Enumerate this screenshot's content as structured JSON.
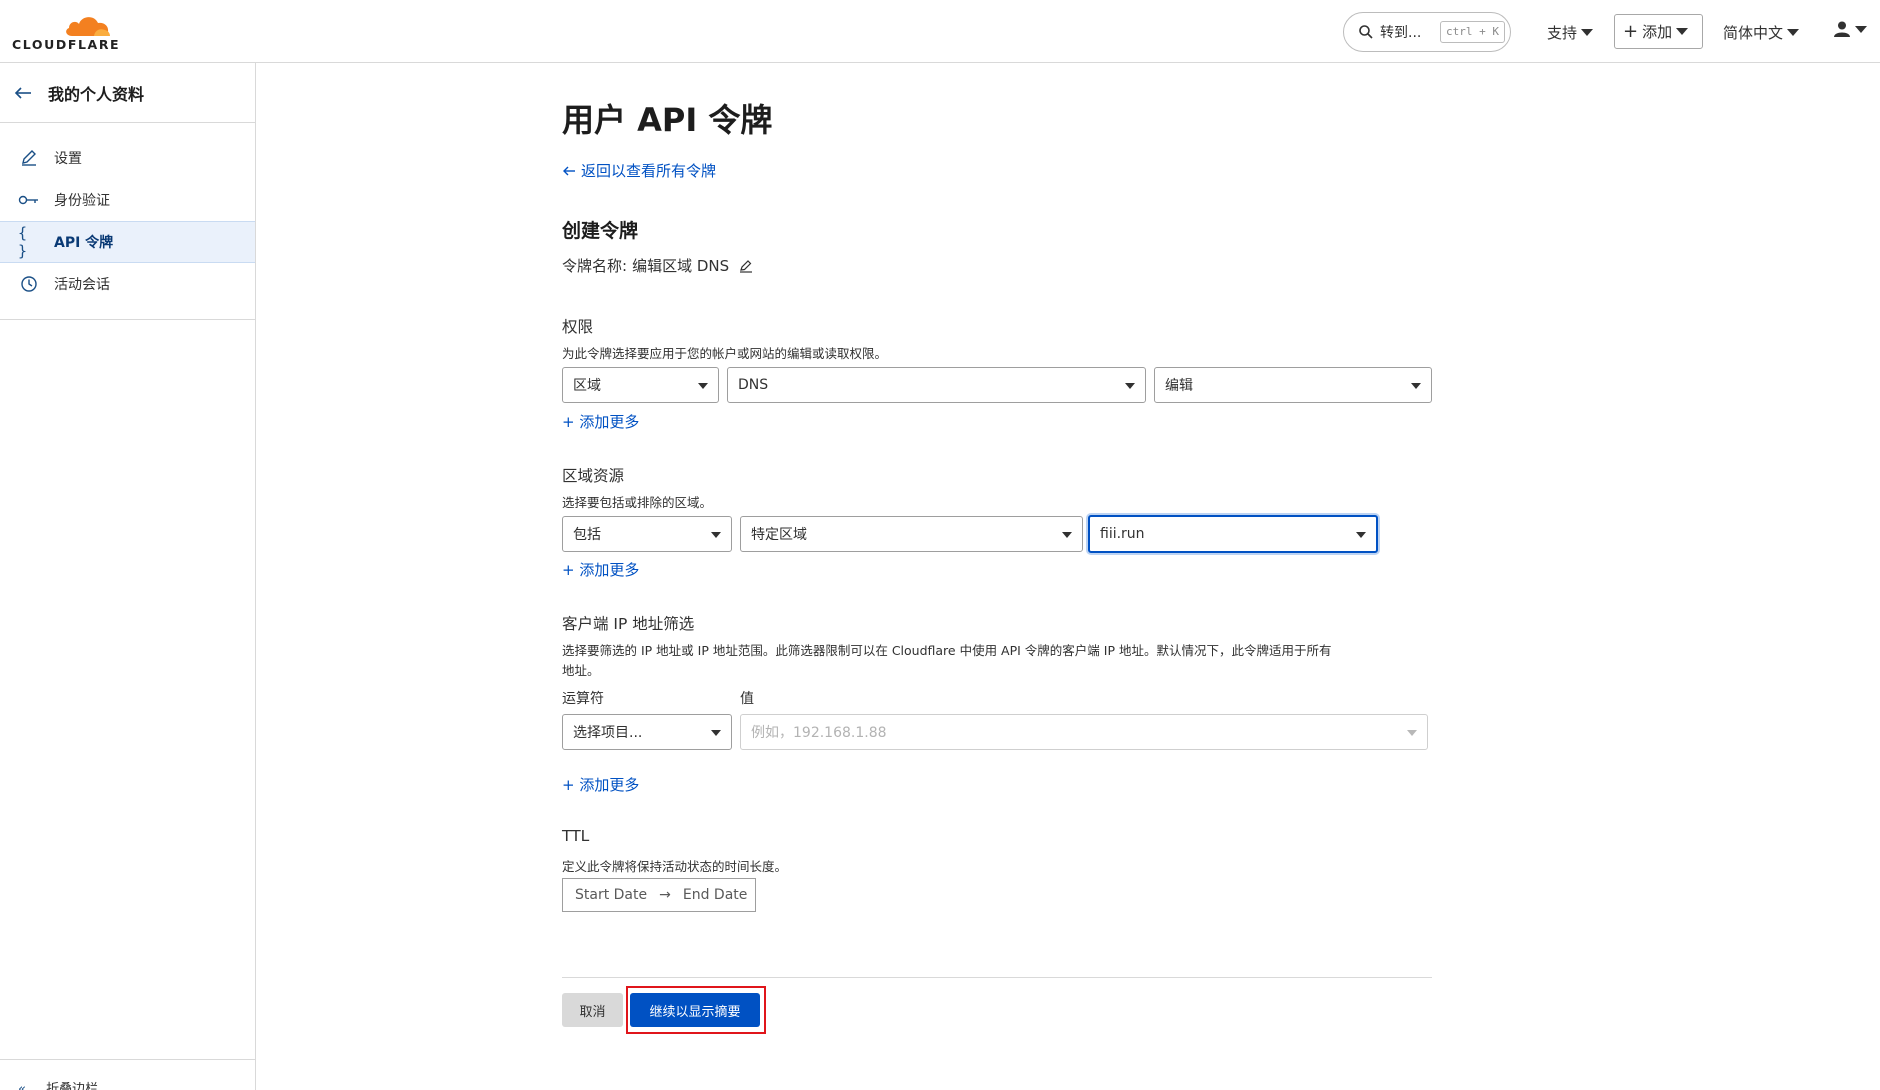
{
  "header": {
    "logo_text": "CLOUDFLARE",
    "search_label": "转到...",
    "search_shortcut": "ctrl + K",
    "support_label": "支持",
    "add_label": "添加",
    "language_label": "简体中文",
    "brand_color": "#f38020",
    "user_icon": "user-icon"
  },
  "sidebar": {
    "back_title": "我的个人资料",
    "items": [
      {
        "label": "设置",
        "icon": "pencil-icon"
      },
      {
        "label": "身份验证",
        "icon": "key-icon"
      },
      {
        "label": "API 令牌",
        "icon": "braces-icon",
        "active": true
      },
      {
        "label": "活动会话",
        "icon": "clock-icon"
      }
    ],
    "footer_label": "折叠边栏"
  },
  "main": {
    "page_title": "用户 API 令牌",
    "back_link": "返回以查看所有令牌",
    "section_title": "创建令牌",
    "token_name_label": "令牌名称:",
    "token_name_value": "编辑区域 DNS",
    "permissions": {
      "label": "权限",
      "description": "为此令牌选择要应用于您的帐户或网站的编辑或读取权限。",
      "selects": [
        "区域",
        "DNS",
        "编辑"
      ],
      "add_more": "+ 添加更多"
    },
    "zone_resources": {
      "label": "区域资源",
      "description": "选择要包括或排除的区域。",
      "selects": [
        "包括",
        "特定区域",
        "fiii.run"
      ],
      "add_more": "+ 添加更多"
    },
    "ip_filter": {
      "label": "客户端 IP 地址筛选",
      "description_line1": "选择要筛选的 IP 地址或 IP 地址范围。此筛选器限制可以在 Cloudflare 中使用 API 令牌的客户端 IP 地址。默认情况下，此令牌适用于所有",
      "description_line2": "地址。",
      "operator_label": "运算符",
      "value_label": "值",
      "operator_placeholder": "选择项目...",
      "value_placeholder": "例如，192.168.1.88",
      "add_more": "+ 添加更多"
    },
    "ttl": {
      "label": "TTL",
      "description": "定义此令牌将保持活动状态的时间长度。",
      "start_date": "Start Date",
      "end_date": "End Date"
    },
    "buttons": {
      "cancel": "取消",
      "continue": "继续以显示摘要"
    },
    "accent_color": "#0051c3",
    "highlight_color": "#e0151b"
  }
}
